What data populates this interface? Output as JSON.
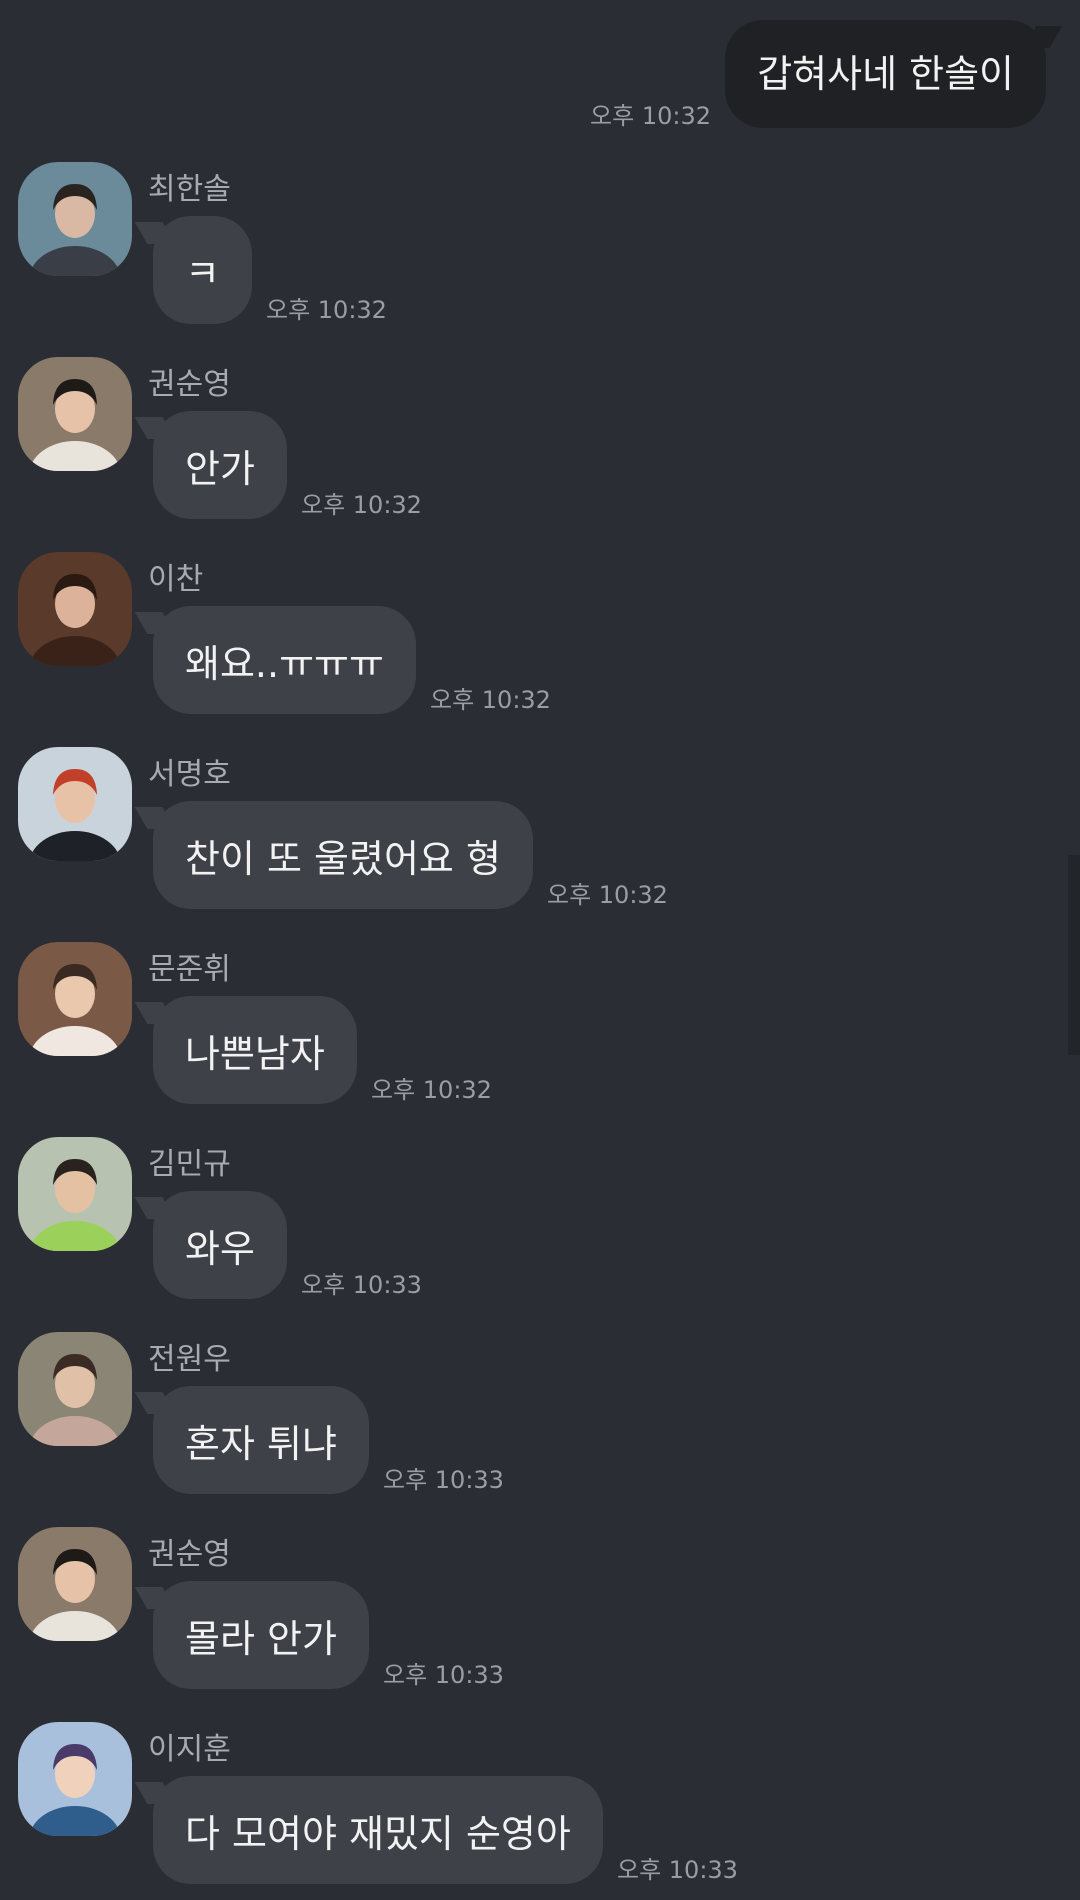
{
  "outgoing": {
    "text": "갑혀사네 한솔이",
    "time": "오후 10:32"
  },
  "messages": [
    {
      "name": "최한솔",
      "text": "ㅋ",
      "time": "오후 10:32",
      "avatar": "avatar-choi-hansol"
    },
    {
      "name": "권순영",
      "text": "안가",
      "time": "오후 10:32",
      "avatar": "avatar-kwon-soonyoung"
    },
    {
      "name": "이찬",
      "text": "왜요..ㅠㅠㅠ",
      "time": "오후 10:32",
      "avatar": "avatar-lee-chan"
    },
    {
      "name": "서명호",
      "text": "찬이 또 울렸어요 형",
      "time": "오후 10:32",
      "avatar": "avatar-seo-myungho"
    },
    {
      "name": "문준휘",
      "text": "나쁜남자",
      "time": "오후 10:32",
      "avatar": "avatar-moon-junhui"
    },
    {
      "name": "김민규",
      "text": "와우",
      "time": "오후 10:33",
      "avatar": "avatar-kim-mingyu"
    },
    {
      "name": "전원우",
      "text": "혼자 튀냐",
      "time": "오후 10:33",
      "avatar": "avatar-jeon-wonwoo"
    },
    {
      "name": "권순영",
      "text": "몰라 안가",
      "time": "오후 10:33",
      "avatar": "avatar-kwon-soonyoung"
    },
    {
      "name": "이지훈",
      "text": "다 모여야 재밌지 순영아",
      "time": "오후 10:33",
      "avatar": "avatar-lee-jihoon"
    }
  ],
  "colors": {
    "background": "#2a2d33",
    "incoming_bubble": "#3e4148",
    "outgoing_bubble": "#1f2125",
    "text": "#f2f2f2",
    "meta_text": "#9a9da3"
  }
}
